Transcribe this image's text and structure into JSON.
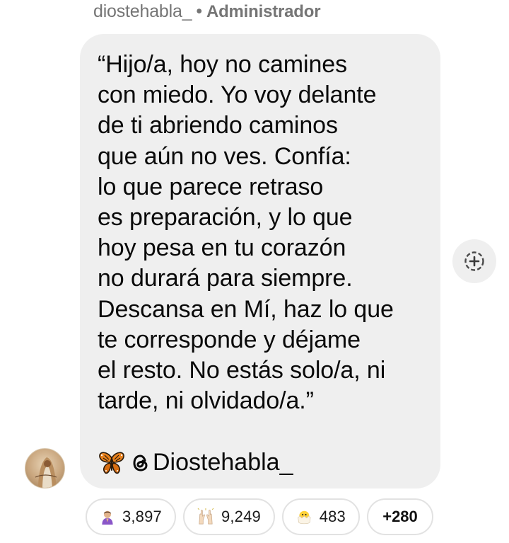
{
  "header": {
    "sender_name": "diostehabla_",
    "separator": "•",
    "sender_role": "Administrador"
  },
  "message": {
    "lines": [
      "“Hijo/a, hoy no camines",
      "con miedo. Yo voy delante",
      "de ti abriendo caminos",
      "que aún no ves. Confía:",
      "lo que parece retraso",
      "es preparación, y lo que",
      "hoy pesa en tu corazón",
      "no durará para siempre.",
      "Descansa en Mí, haz lo que",
      "te corresponde y déjame",
      "el resto. No estás solo/a, ni",
      "tarde, ni olvidado/a.”"
    ],
    "signature_text": "Diostehabla_",
    "signature_icons": [
      "butterfly-icon",
      "threads-icon"
    ]
  },
  "avatar": {
    "icon": "avatar-image"
  },
  "actions": {
    "add_reaction_icon": "add-reaction-icon"
  },
  "reactions": [
    {
      "icon": "person-praying-emoji",
      "count": "3,897"
    },
    {
      "icon": "raised-hands-emoji",
      "count": "9,249"
    },
    {
      "icon": "hatching-chick-emoji",
      "count": "483"
    }
  ],
  "reactions_more": "+280",
  "colors": {
    "bubble_background": "#efefef",
    "meta_text": "#757575",
    "butterfly_orange": "#e8821e",
    "chick_yellow": "#ffd23a"
  }
}
